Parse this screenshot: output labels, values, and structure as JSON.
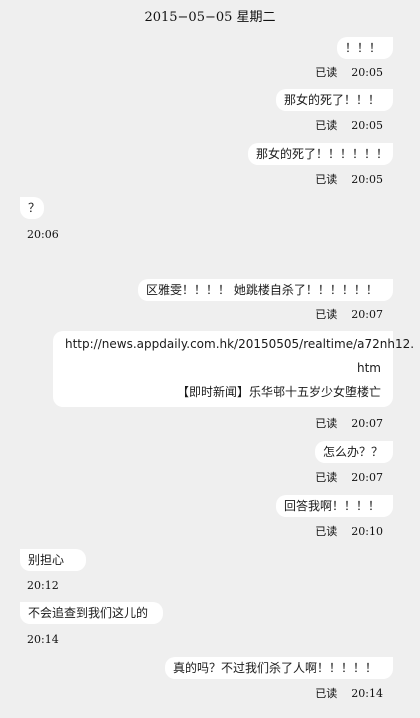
{
  "date_header": "2015−05−05  星期二",
  "read_label": "已读",
  "messages": [
    {
      "text": "！！！",
      "time": "20:05"
    },
    {
      "text": "那女的死了！！！",
      "time": "20:05"
    },
    {
      "text": "那女的死了！！！！！！",
      "time": "20:05"
    },
    {
      "text": "？",
      "time": "20:06"
    },
    {
      "text": "区雅雯！！！！ 她跳楼自杀了！！！！！！",
      "time": "20:07"
    },
    {
      "lines": [
        "http://news.appdaily.com.hk/20150505/realtime/a72nh12.",
        "htm",
        "【即时新闻】乐华邨十五岁少女堕楼亡"
      ],
      "time": "20:07"
    },
    {
      "text": "怎么办？？",
      "time": "20:07"
    },
    {
      "text": "回答我啊！！！！",
      "time": "20:10"
    },
    {
      "text": "别担心",
      "time": "20:12"
    },
    {
      "text": "不会追查到我们这儿的",
      "time": "20:14"
    },
    {
      "text": "真的吗？不过我们杀了人啊！！！！！",
      "time": "20:14"
    }
  ]
}
